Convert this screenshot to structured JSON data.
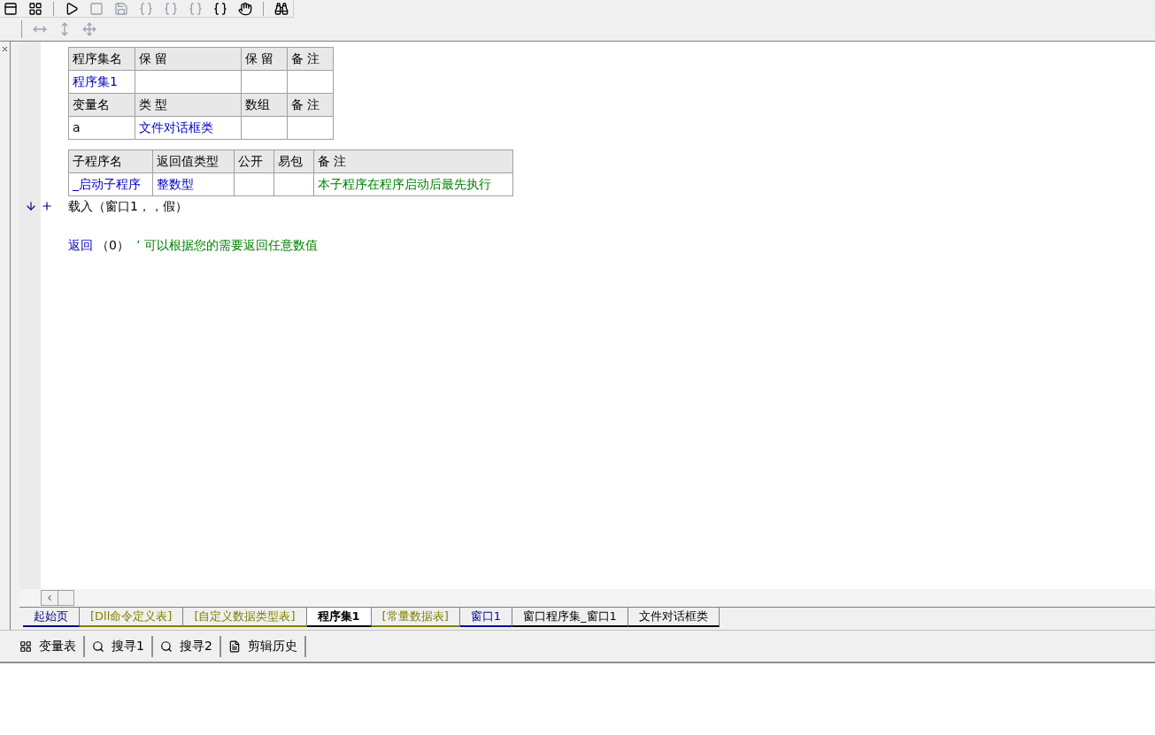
{
  "assembly_table": {
    "header": [
      "程序集名",
      "保 留",
      "保 留",
      "备 注"
    ],
    "row": [
      "程序集1"
    ],
    "var_header": [
      "变量名",
      "类 型",
      "数组",
      "备 注"
    ],
    "var_row": [
      "a",
      "文件对话框类"
    ]
  },
  "sub_table": {
    "header": [
      "子程序名",
      "返回值类型",
      "公开",
      "易包",
      "备 注"
    ],
    "row": {
      "name": "_启动子程序",
      "return_type": "整数型",
      "note": "本子程序在程序启动后最先执行"
    }
  },
  "code_lines": [
    {
      "kind": "call",
      "text": "载入（窗口1，，假）",
      "current": true
    },
    {
      "kind": "blank"
    },
    {
      "kind": "return",
      "keyword": "返回",
      "args": "（0）",
      "comment": "’ 可以根据您的需要返回任意数值",
      "current": false
    }
  ],
  "doc_tabs": [
    {
      "label": "起始页",
      "color": "#000080",
      "selected": false
    },
    {
      "label": "[Dll命令定义表]",
      "color": "#808000",
      "selected": false
    },
    {
      "label": "[自定义数据类型表]",
      "color": "#808000",
      "selected": false
    },
    {
      "label": "程序集1",
      "color": "#000000",
      "selected": true
    },
    {
      "label": "[常量数据表]",
      "color": "#808000",
      "selected": false
    },
    {
      "label": "窗口1",
      "color": "#0000a0",
      "selected": false
    },
    {
      "label": "窗口程序集_窗口1",
      "color": "#000000",
      "selected": false
    },
    {
      "label": "文件对话框类",
      "color": "#000000",
      "selected": false
    }
  ],
  "bottom_tabs": [
    {
      "label": "变量表",
      "kind": "variables"
    },
    {
      "label": "搜寻1",
      "kind": "search"
    },
    {
      "label": "搜寻2",
      "kind": "search"
    },
    {
      "label": "剪辑历史",
      "kind": "history"
    }
  ]
}
